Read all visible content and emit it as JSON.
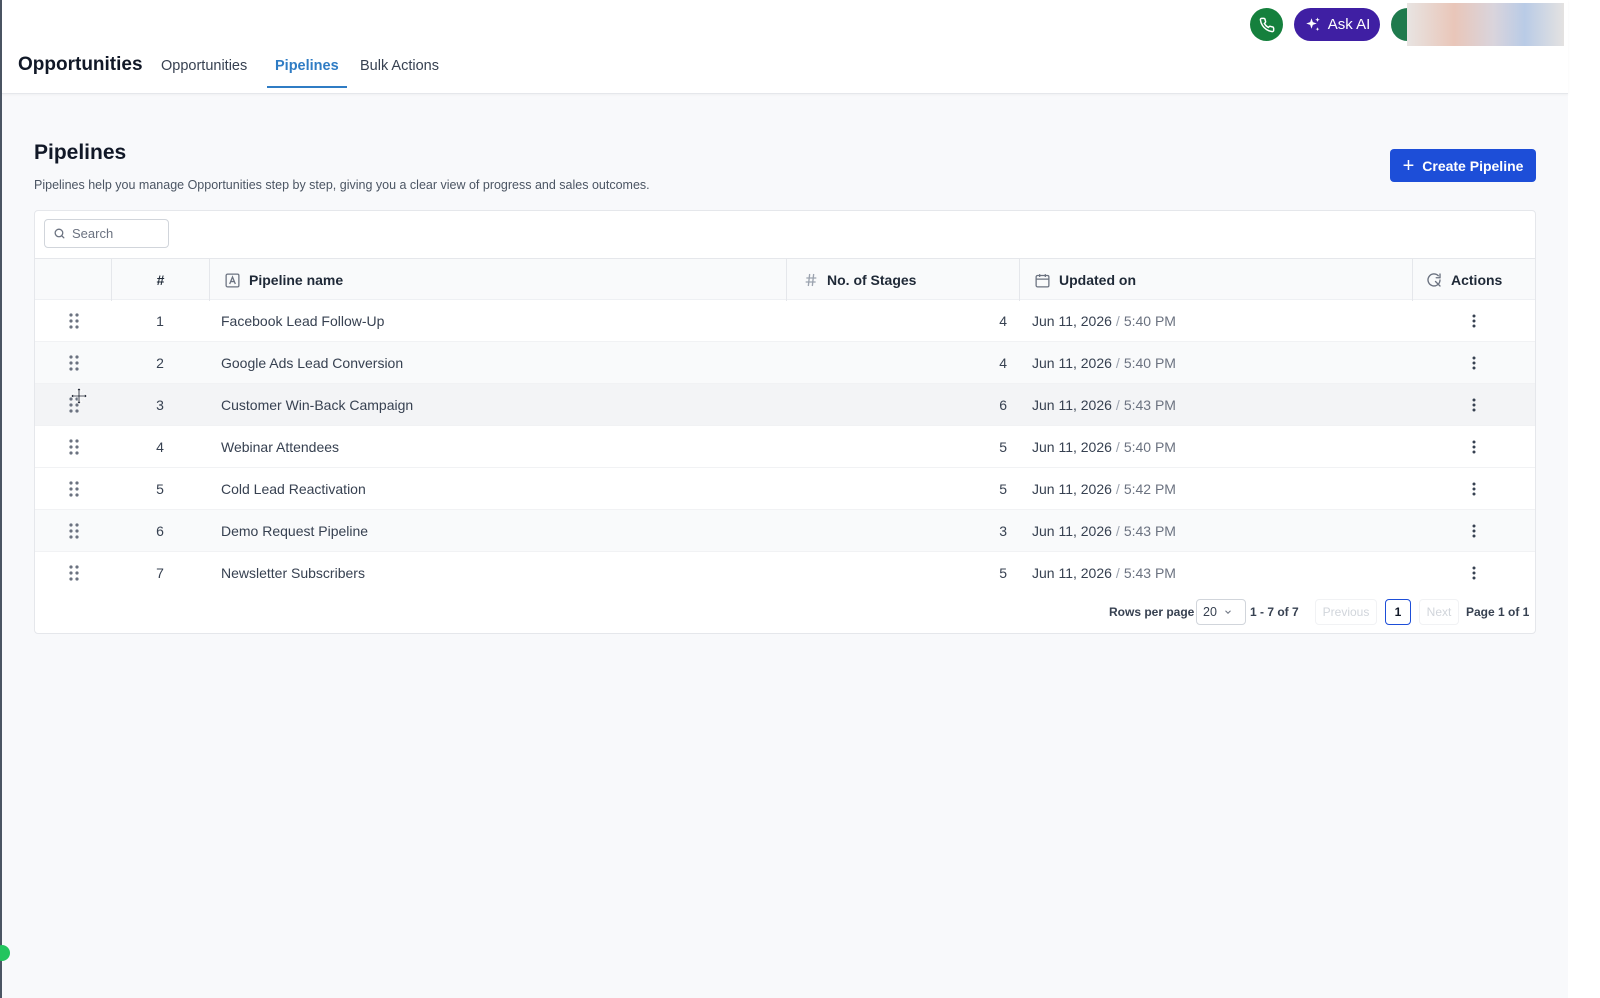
{
  "header": {
    "app_title": "Opportunities",
    "tabs": [
      {
        "label": "Opportunities",
        "active": false
      },
      {
        "label": "Pipelines",
        "active": true
      },
      {
        "label": "Bulk Actions",
        "active": false
      }
    ],
    "ask_ai_label": "Ask AI",
    "phone_icon": "phone-icon",
    "accent_color": "#2f7cc4"
  },
  "page": {
    "title": "Pipelines",
    "description": "Pipelines help you manage Opportunities step by step, giving you a clear view of progress and sales outcomes.",
    "create_button_label": "Create Pipeline",
    "create_button_color": "#1d4ed8"
  },
  "search": {
    "placeholder": "Search",
    "value": ""
  },
  "table": {
    "columns": [
      "#",
      "Pipeline name",
      "No. of Stages",
      "Updated on",
      "Actions"
    ],
    "rows": [
      {
        "num": "1",
        "name": "Facebook Lead Follow-Up",
        "stages": "4",
        "date": "Jun 11, 2026",
        "time": "5:40 PM"
      },
      {
        "num": "2",
        "name": "Google Ads Lead Conversion",
        "stages": "4",
        "date": "Jun 11, 2026",
        "time": "5:40 PM"
      },
      {
        "num": "3",
        "name": "Customer Win-Back Campaign",
        "stages": "6",
        "date": "Jun 11, 2026",
        "time": "5:43 PM"
      },
      {
        "num": "4",
        "name": "Webinar Attendees",
        "stages": "5",
        "date": "Jun 11, 2026",
        "time": "5:40 PM"
      },
      {
        "num": "5",
        "name": "Cold Lead Reactivation",
        "stages": "5",
        "date": "Jun 11, 2026",
        "time": "5:42 PM"
      },
      {
        "num": "6",
        "name": "Demo Request Pipeline",
        "stages": "3",
        "date": "Jun 11, 2026",
        "time": "5:43 PM"
      },
      {
        "num": "7",
        "name": "Newsletter Subscribers",
        "stages": "5",
        "date": "Jun 11, 2026",
        "time": "5:43 PM"
      }
    ]
  },
  "pagination": {
    "rows_per_page_label": "Rows per page",
    "rows_per_page_value": "20",
    "range": "1 - 7 of 7",
    "previous_label": "Previous",
    "current_page": "1",
    "next_label": "Next",
    "page_of": "Page 1 of 1"
  }
}
